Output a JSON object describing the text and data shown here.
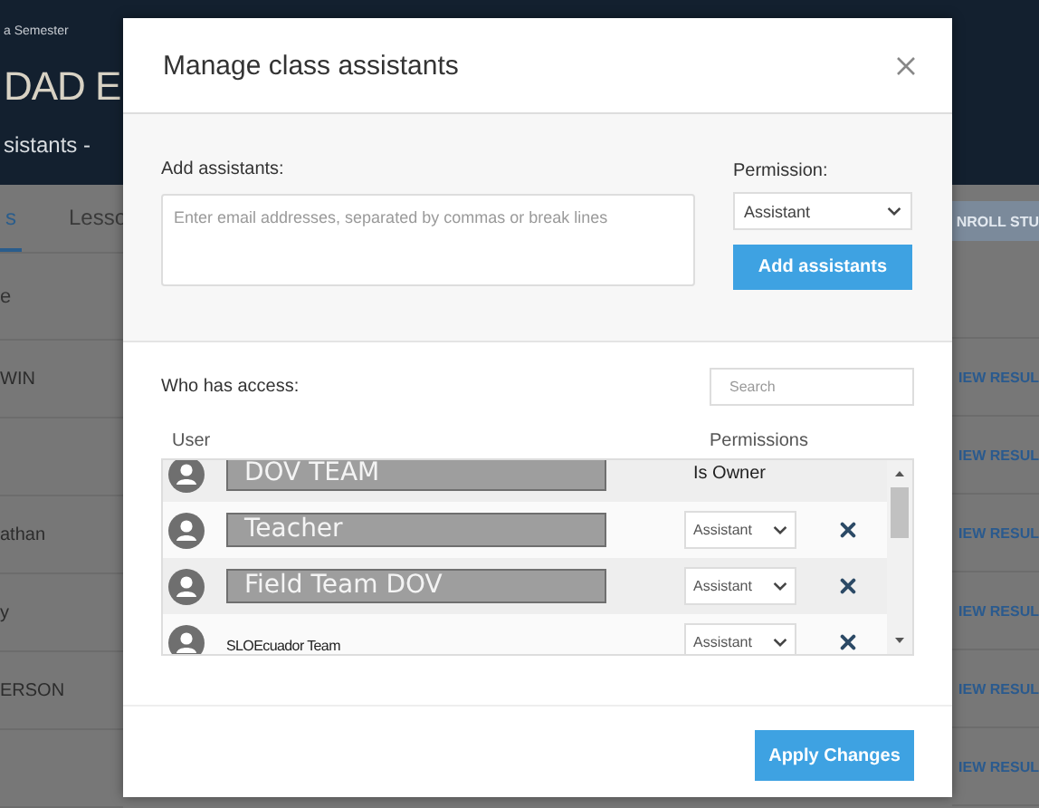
{
  "background": {
    "semester": "a Semester",
    "course_title": "DAD E",
    "nav_menu": "sistants -",
    "tabs": [
      {
        "label": "s",
        "selected": true
      },
      {
        "label": "Lesso",
        "selected": false
      }
    ],
    "enroll_button": "NROLL STU",
    "column_header": "e",
    "rows": [
      {
        "name": "WIN",
        "action": "IEW RESUL"
      },
      {
        "action": "IEW RESUL"
      },
      {
        "name": "athan",
        "action": "IEW RESUL"
      },
      {
        "name": "y",
        "action": "IEW RESUL"
      },
      {
        "name": "ERSON",
        "action": "IEW RESUL"
      },
      {
        "action": "IEW RESUL"
      }
    ]
  },
  "dialog": {
    "title": "Manage class assistants",
    "add_label": "Add assistants:",
    "emails": {
      "placeholder": "Enter email addresses, separated by commas or break lines"
    },
    "permission_label": "Permission:",
    "permission": {
      "value": "Assistant"
    },
    "add_button": "Add assistants",
    "access_label": "Who has access:",
    "search": {
      "placeholder": "Search"
    },
    "columns": [
      "User",
      "Permissions"
    ],
    "users": [
      {
        "name": "DOV TEAM",
        "redacted": true,
        "kind": "owner",
        "permission": "Is Owner"
      },
      {
        "name": "Teacher",
        "redacted": true,
        "kind": "member",
        "permission": "Assistant"
      },
      {
        "name": "Field Team DOV",
        "redacted": true,
        "kind": "member",
        "permission": "Assistant"
      },
      {
        "name": "SLOEcuador Team",
        "redacted": false,
        "kind": "member",
        "permission": "Assistant"
      }
    ],
    "apply_button": "Apply Changes"
  }
}
